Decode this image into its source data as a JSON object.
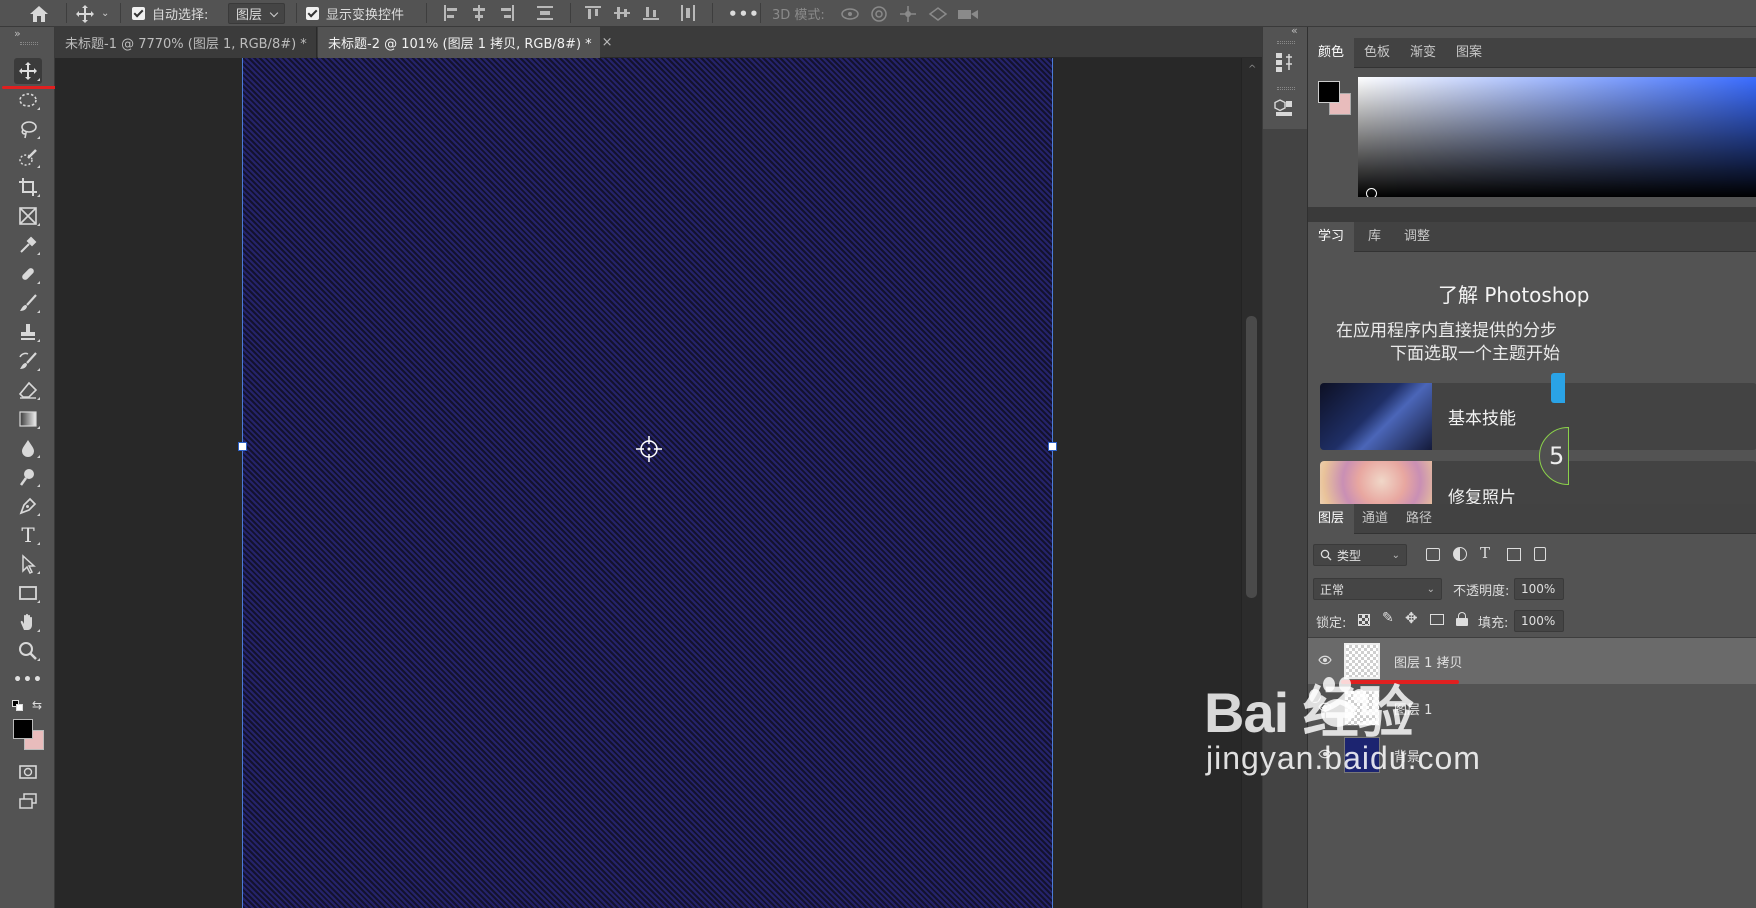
{
  "options_bar": {
    "auto_select_label": "自动选择:",
    "auto_select_value": "图层",
    "show_transform_label": "显示变换控件",
    "more_label": "•••",
    "mode_3d_label": "3D 模式:"
  },
  "tabs": [
    {
      "label": "未标题-1 @ 7770% (图层 1, RGB/8#) *",
      "active": false
    },
    {
      "label": "未标题-2 @ 101% (图层 1 拷贝, RGB/8#) *",
      "active": true
    }
  ],
  "tab_close_glyph": "×",
  "tools": [
    {
      "name": "move-tool",
      "icon": "move-icon",
      "active": true
    },
    {
      "name": "elliptical-marquee-tool",
      "icon": "ellipse-marquee-icon"
    },
    {
      "name": "lasso-tool",
      "icon": "lasso-icon"
    },
    {
      "name": "quick-selection-tool",
      "icon": "quick-selection-icon"
    },
    {
      "name": "crop-tool",
      "icon": "crop-icon"
    },
    {
      "name": "frame-tool",
      "icon": "frame-icon"
    },
    {
      "name": "eyedropper-tool",
      "icon": "eyedropper-icon"
    },
    {
      "name": "healing-brush-tool",
      "icon": "bandage-icon"
    },
    {
      "name": "brush-tool",
      "icon": "brush-icon"
    },
    {
      "name": "clone-stamp-tool",
      "icon": "stamp-icon"
    },
    {
      "name": "history-brush-tool",
      "icon": "history-brush-icon"
    },
    {
      "name": "eraser-tool",
      "icon": "eraser-icon"
    },
    {
      "name": "gradient-tool",
      "icon": "gradient-icon"
    },
    {
      "name": "blur-tool",
      "icon": "drop-icon"
    },
    {
      "name": "dodge-tool",
      "icon": "dodge-icon"
    },
    {
      "name": "pen-tool",
      "icon": "pen-icon"
    },
    {
      "name": "type-tool",
      "icon": "type-icon",
      "glyph": "T"
    },
    {
      "name": "path-selection-tool",
      "icon": "arrow-icon"
    },
    {
      "name": "rectangle-tool",
      "icon": "rectangle-icon"
    },
    {
      "name": "hand-tool",
      "icon": "hand-icon"
    },
    {
      "name": "zoom-tool",
      "icon": "zoom-icon"
    },
    {
      "name": "edit-toolbar",
      "icon": "more-icon",
      "glyph": "•••"
    }
  ],
  "colors": {
    "foreground": "#000000",
    "background": "#e8bcbc",
    "accent_red": "#e02020",
    "selection_blue": "#4a7bd6"
  },
  "color_panel": {
    "tabs": [
      "颜色",
      "色板",
      "渐变",
      "图案"
    ],
    "active_tab": "颜色"
  },
  "learn_panel": {
    "tabs": [
      "学习",
      "库",
      "调整"
    ],
    "active_tab": "学习",
    "title": "了解 Photoshop",
    "desc_line1": "在应用程序内直接提供的分步",
    "desc_line2": "下面选取一个主题开始",
    "cards": [
      {
        "label": "基本技能"
      },
      {
        "label": "修复照片"
      }
    ],
    "badge_text": "5"
  },
  "layers_panel": {
    "tabs": [
      "图层",
      "通道",
      "路径"
    ],
    "active_tab": "图层",
    "filter_label": "类型",
    "blend_mode": "正常",
    "opacity_label": "不透明度:",
    "opacity_value": "100%",
    "lock_label": "锁定:",
    "fill_label": "填充:",
    "fill_value": "100%",
    "layers": [
      {
        "name": "图层 1 拷贝",
        "selected": true
      },
      {
        "name": "图层 1",
        "selected": false
      },
      {
        "name": "背景",
        "selected": false
      }
    ]
  },
  "watermark": {
    "logo": "Bai  经验",
    "url": "jingyan.baidu.com"
  }
}
